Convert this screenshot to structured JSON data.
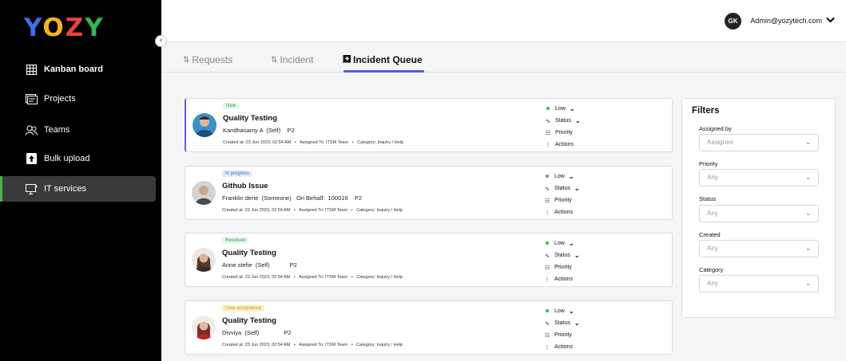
{
  "logo": [
    "Y",
    "O",
    "Z",
    "Y"
  ],
  "sidebar": {
    "collapse_icon": "‹",
    "items": [
      {
        "label": "Kanban board",
        "icon": "kanban-icon"
      },
      {
        "label": "Projects",
        "icon": "projects-icon"
      },
      {
        "label": "Teams",
        "icon": "teams-icon"
      },
      {
        "label": "Bulk upload",
        "icon": "upload-icon"
      },
      {
        "label": "IT services",
        "icon": "monitor-icon"
      }
    ]
  },
  "header": {
    "avatar_initials": "GK",
    "user": "Admin@yozytech.com"
  },
  "tabs": [
    {
      "label": "Requests"
    },
    {
      "label": "Incident"
    },
    {
      "label": "Incident Queue"
    }
  ],
  "cards": [
    {
      "badge": "New",
      "title": "Quality Testing",
      "sub": "Kandhasamy A  (Self)    P2",
      "meta": "Created at: 23 Jun 2023, 02:54 AM   •   Assigned To: ITSM Team   •   Category: Inquiry / Help",
      "priority": "Low",
      "status": "Status",
      "priority_label": "Priority",
      "actions": "Actions"
    },
    {
      "badge": "In progress",
      "title": "Github Issue",
      "sub": "Franklin derie  (Someone)   On Behalf:  100016    P2",
      "meta": "Created at: 23 Jun 2023, 02:54 AM   •   Assigned To: ITSM Team   •   Category: Inquiry / Help",
      "priority": "Low",
      "status": "Status",
      "priority_label": "Priority",
      "actions": "Actions"
    },
    {
      "badge": "Resolved",
      "title": "Quality Testing",
      "sub": "Anne stefie  (Self)            P2",
      "meta": "Created at: 23 Jun 2023, 02:54 AM   •   Assigned To: ITSM Team   •   Category: Inquiry / Help",
      "priority": "Low",
      "status": "Status",
      "priority_label": "Priority",
      "actions": "Actions"
    },
    {
      "badge": "User acceptance",
      "title": "Quality Testing",
      "sub": "Divviya  (Self)               P2",
      "meta": "Created at: 23 Jun 2023, 02:54 AM   •   Assigned To: ITSM Team   •   Category: Inquiry / Help",
      "priority": "Low",
      "status": "Status",
      "priority_label": "Priority",
      "actions": "Actions"
    }
  ],
  "filters": {
    "title": "Filters",
    "fields": [
      {
        "label": "Assigned by",
        "value": "Assignee"
      },
      {
        "label": "Priority",
        "value": "Any"
      },
      {
        "label": "Status",
        "value": "Any"
      },
      {
        "label": "Created",
        "value": "Any"
      },
      {
        "label": "Category",
        "value": "Any"
      }
    ]
  },
  "colors": {
    "accent": "#5b5bd6",
    "badge_new": "#e6f7ea",
    "badge_progress": "#e2ecfb",
    "badge_resolved": "#e6f7ea",
    "badge_uat": "#fdf0c7",
    "priority_low": "#4caf50"
  }
}
